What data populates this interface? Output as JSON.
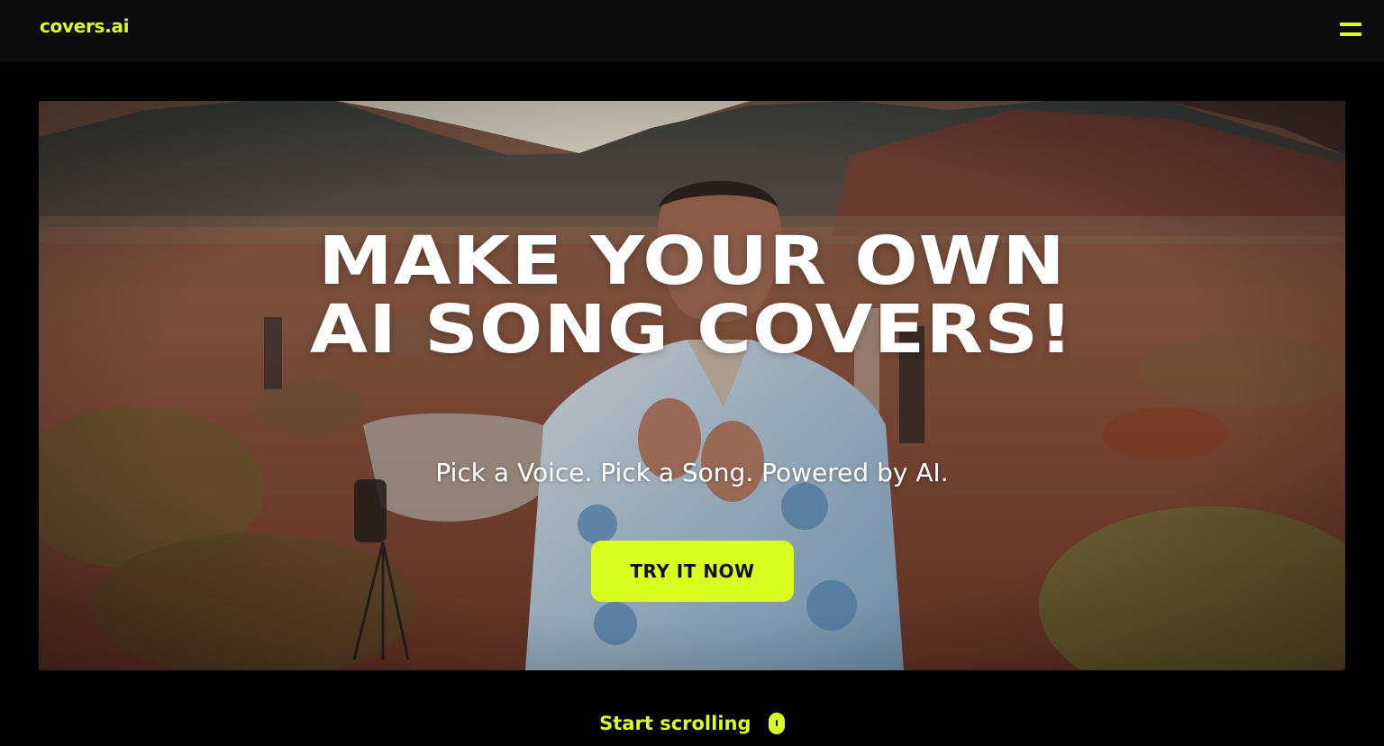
{
  "header": {
    "logo_text": "covers.ai",
    "menu_icon": "hamburger-menu-icon"
  },
  "hero": {
    "title_line1": "MAKE YOUR OWN",
    "title_line2": "AI SONG COVERS!",
    "subtitle": "Pick a Voice. Pick a Song. Powered by AI.",
    "cta_label": "TRY IT NOW"
  },
  "footer_hint": {
    "label": "Start scrolling",
    "icon": "mouse-scroll-icon"
  },
  "colors": {
    "accent": "#d8ff1f",
    "header_bg": "#0c0c0c",
    "page_bg": "#000000"
  }
}
